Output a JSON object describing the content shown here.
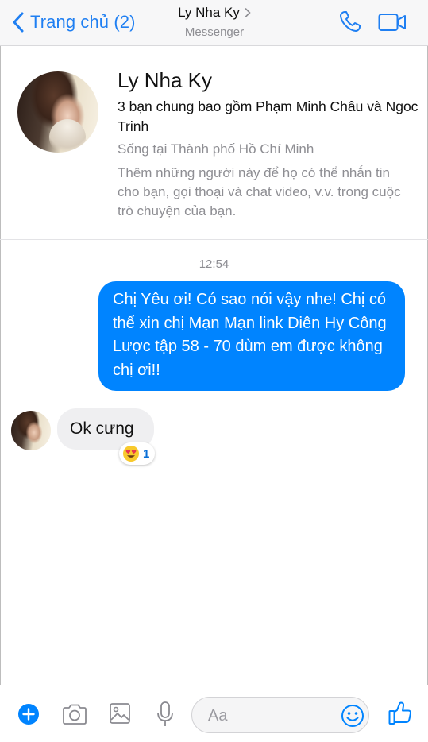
{
  "header": {
    "back_label": "Trang chủ (2)",
    "title": "Ly Nha Ky",
    "subtitle": "Messenger"
  },
  "profile": {
    "name": "Ly Nha Ky",
    "mutual_friends": "3 bạn chung bao gồm Phạm Minh Châu và Ngoc Trinh",
    "lives_in": "Sống tại Thành phố Hồ Chí Minh",
    "hint": "Thêm những người này để họ có thể nhắn tin cho bạn, gọi thoại và chat video, v.v. trong cuộc trò chuyện của bạn."
  },
  "chat": {
    "timestamp": "12:54",
    "messages": [
      {
        "direction": "outgoing",
        "text": "Chị Yêu ơi! Có sao nói vậy nhe! Chị có thể xin chị Mạn Mạn link Diên Hy Công Lược tập 58 - 70 dùm em được không chị ơi!!"
      },
      {
        "direction": "incoming",
        "text": "Ok cưng",
        "reaction": {
          "emoji": "heart-eyes-emoji",
          "count": "1"
        }
      }
    ]
  },
  "composer": {
    "placeholder": "Aa",
    "icons": [
      "plus-icon",
      "camera-icon",
      "gallery-icon",
      "microphone-icon",
      "emoji-icon",
      "like-icon"
    ]
  },
  "colors": {
    "accent": "#0084ff",
    "link": "#1f7ff2",
    "incoming_bubble": "#efeff1",
    "secondary_text": "#8e8e93"
  }
}
